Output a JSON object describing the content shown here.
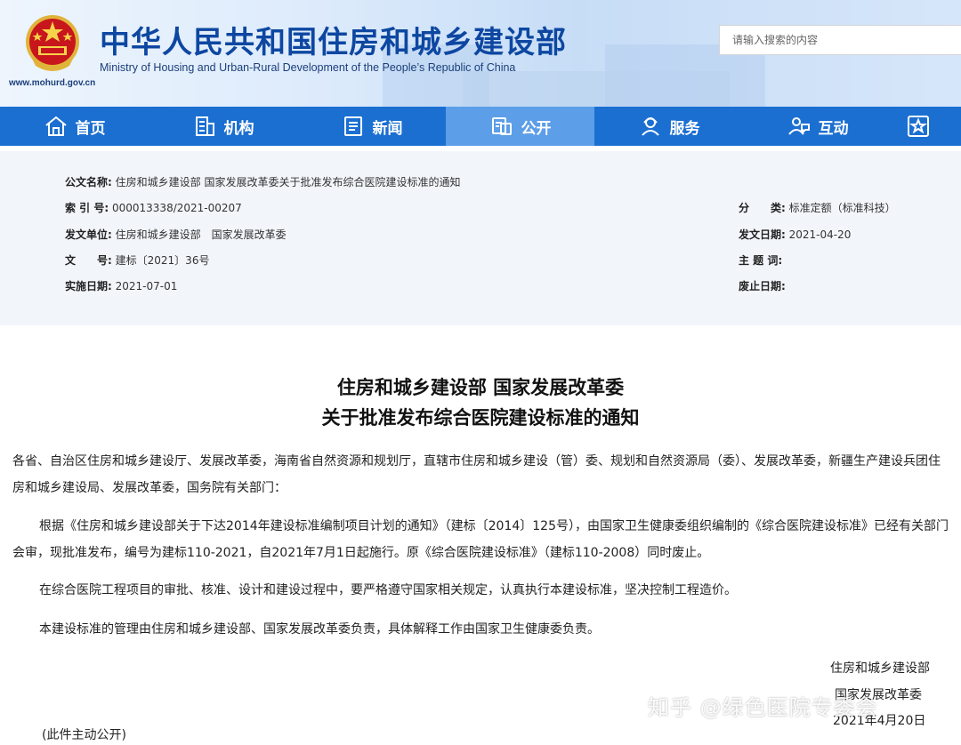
{
  "header": {
    "site_url": "www.mohurd.gov.cn",
    "title": "中华人民共和国住房和城乡建设部",
    "subtitle": "Ministry of Housing and Urban-Rural Development of the People’s Republic of China",
    "search_placeholder": "请输入搜索的内容"
  },
  "nav": {
    "items": [
      {
        "label": "首页",
        "icon": "home-icon"
      },
      {
        "label": "机构",
        "icon": "building-icon"
      },
      {
        "label": "新闻",
        "icon": "news-icon"
      },
      {
        "label": "公开",
        "icon": "disclosure-icon"
      },
      {
        "label": "服务",
        "icon": "service-icon"
      },
      {
        "label": "互动",
        "icon": "interaction-icon"
      }
    ],
    "active_index": 3,
    "end_icon": "star-box-icon"
  },
  "meta": {
    "doc_name_label": "公文名称:",
    "doc_name_value": "住房和城乡建设部 国家发展改革委关于批准发布综合医院建设标准的通知",
    "index_label": "索 引 号:",
    "index_value": "000013338/2021-00207",
    "issuer_label": "发文单位:",
    "issuer_value": "住房和城乡建设部　国家发展改革委",
    "docno_label": "文　　号:",
    "docno_value": "建标〔2021〕36号",
    "effective_label": "实施日期:",
    "effective_value": "2021-07-01",
    "category_label": "分　　类:",
    "category_value": "标准定额（标准科技）",
    "issue_date_label": "发文日期:",
    "issue_date_value": "2021-04-20",
    "keywords_label": "主 题 词:",
    "keywords_value": "",
    "repeal_label": "废止日期:",
    "repeal_value": ""
  },
  "document": {
    "title_line1": "住房和城乡建设部 国家发展改革委",
    "title_line2": "关于批准发布综合医院建设标准的通知",
    "salutation": "各省、自治区住房和城乡建设厅、发展改革委，海南省自然资源和规划厅，直辖市住房和城乡建设（管）委、规划和自然资源局（委）、发展改革委，新疆生产建设兵团住房和城乡建设局、发展改革委，国务院有关部门：",
    "para1": "根据《住房和城乡建设部关于下达2014年建设标准编制项目计划的通知》（建标〔2014〕125号），由国家卫生健康委组织编制的《综合医院建设标准》已经有关部门会审，现批准发布，编号为建标110-2021，自2021年7月1日起施行。原《综合医院建设标准》（建标110-2008）同时废止。",
    "para2": "在综合医院工程项目的审批、核准、设计和建设过程中，要严格遵守国家相关规定，认真执行本建设标准，坚决控制工程造价。",
    "para3": "本建设标准的管理由住房和城乡建设部、国家发展改革委负责，具体解释工作由国家卫生健康委负责。",
    "sig1": "住房和城乡建设部",
    "sig2": "国家发展改革委",
    "date": "2021年4月20日",
    "footer": "(此件主动公开)"
  },
  "watermark": "知乎 @绿色医院专委会",
  "colors": {
    "nav_bg": "#1b6fd1",
    "nav_active": "#5c9ee8",
    "title_blue": "#0d47a1",
    "meta_bg": "#f2f6fb"
  }
}
